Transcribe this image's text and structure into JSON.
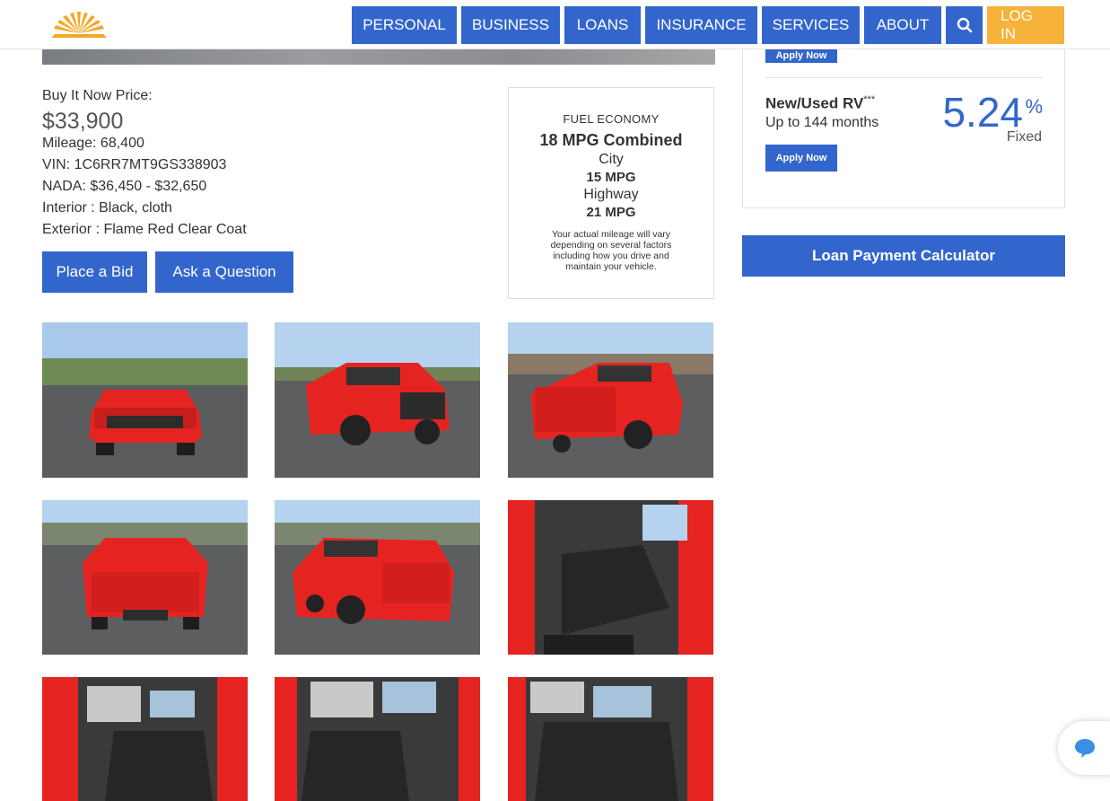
{
  "nav": {
    "items": [
      "PERSONAL",
      "BUSINESS",
      "LOANS",
      "INSURANCE",
      "SERVICES",
      "ABOUT"
    ],
    "login": "LOG IN"
  },
  "listing": {
    "price_label": "Buy It Now Price:",
    "price": "$33,900",
    "mileage": "Mileage: 68,400",
    "vin": "VIN: 1C6RR7MT9GS338903",
    "nada": "NADA: $36,450 - $32,650",
    "interior": "Interior : Black, cloth",
    "exterior": "Exterior : Flame Red Clear Coat",
    "bid_label": "Place a Bid",
    "question_label": "Ask a Question"
  },
  "fuel": {
    "title": "FUEL ECONOMY",
    "combined": "18 MPG Combined",
    "city_label": "City",
    "city_value": "15 MPG",
    "highway_label": "Highway",
    "highway_value": "21 MPG",
    "note": "Your actual mileage will vary depending on several factors including how you drive and maintain your vehicle."
  },
  "rates": {
    "apply_label": "Apply Now",
    "rate_name": "New/Used RV",
    "rate_mark": "***",
    "rate_term": "Up to 144 months",
    "rate_value": "5.24",
    "rate_pct": "%",
    "rate_type": "Fixed"
  },
  "calculator_label": "Loan Payment Calculator",
  "colors": {
    "primary": "#3366cc",
    "accent": "#f6b23a",
    "truck_red": "#e52421"
  }
}
